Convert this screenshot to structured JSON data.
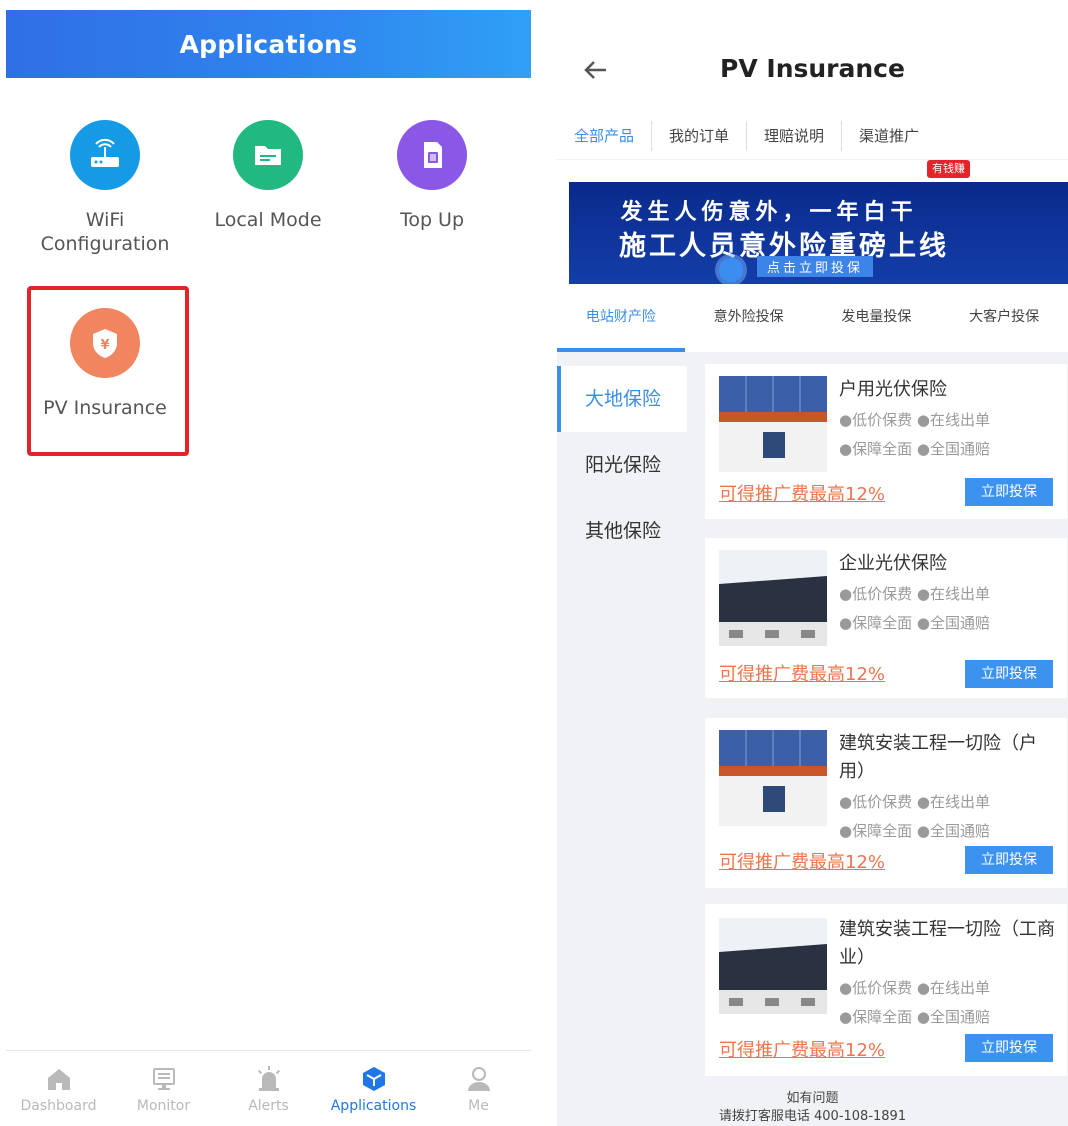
{
  "left": {
    "header_title": "Applications",
    "apps": [
      {
        "label": "WiFi Configuration",
        "icon": "router-icon",
        "color": "#159be6"
      },
      {
        "label": "Local Mode",
        "icon": "folder-icon",
        "color": "#22b981"
      },
      {
        "label": "Top Up",
        "icon": "sim-card-icon",
        "color": "#8a57e7"
      },
      {
        "label": "PV Insurance",
        "icon": "yuan-shield-icon",
        "color": "#f0855f"
      }
    ],
    "tabs": [
      {
        "label": "Dashboard",
        "icon": "home-icon"
      },
      {
        "label": "Monitor",
        "icon": "monitor-icon"
      },
      {
        "label": "Alerts",
        "icon": "alarm-icon"
      },
      {
        "label": "Applications",
        "icon": "cube-icon",
        "active": true
      },
      {
        "label": "Me",
        "icon": "user-icon"
      }
    ]
  },
  "right": {
    "title": "PV Insurance",
    "top_tabs": [
      "全部产品",
      "我的订单",
      "理赔说明",
      "渠道推广"
    ],
    "badge": "有钱赚",
    "banner": {
      "line1": "发生人伤意外，一年白干",
      "line2": "施工人员意外险重磅上线",
      "button": "点击立即投保"
    },
    "cat_tabs": [
      "电站财产险",
      "意外险投保",
      "发电量投保",
      "大客户投保"
    ],
    "side_nav": [
      "大地保险",
      "阳光保险",
      "其他保险"
    ],
    "products": [
      {
        "name": "户用光伏保险",
        "tags": [
          "●低价保费 ●在线出单",
          "●保障全面 ●全国通赔"
        ],
        "promo": "可得推广费最高12%",
        "button": "立即投保"
      },
      {
        "name": "企业光伏保险",
        "tags": [
          "●低价保费 ●在线出单",
          "●保障全面 ●全国通赔"
        ],
        "promo": "可得推广费最高12%",
        "button": "立即投保"
      },
      {
        "name": "建筑安装工程一切险（户用）",
        "tags": [
          "●低价保费 ●在线出单",
          "●保障全面 ●全国通赔"
        ],
        "promo": "可得推广费最高12%",
        "button": "立即投保"
      },
      {
        "name": "建筑安装工程一切险（工商业）",
        "tags": [
          "●低价保费 ●在线出单",
          "●保障全面 ●全国通赔"
        ],
        "promo": "可得推广费最高12%",
        "button": "立即投保"
      }
    ],
    "footer": {
      "line1": "如有问题",
      "line2": "请拨打客服电话 400-108-1891"
    }
  }
}
